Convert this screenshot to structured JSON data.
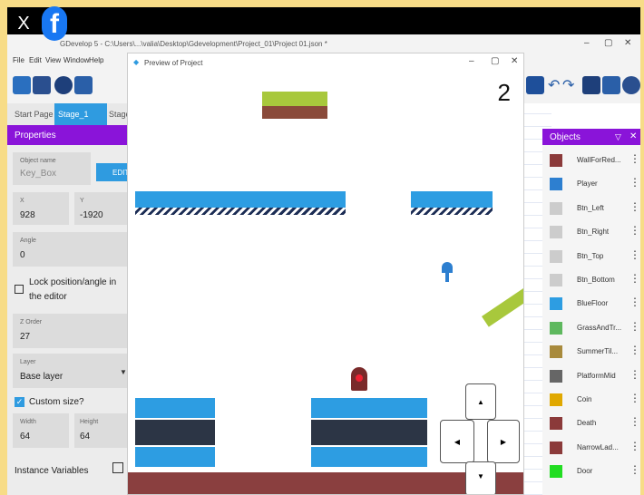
{
  "overlay": {
    "close": "X",
    "fb": "f"
  },
  "editor": {
    "title": "GDevelop 5 - C:\\Users\\...\\valia\\Desktop\\Gdevelopment\\Project_01\\Project 01.json *",
    "menu": [
      "File",
      "Edit",
      "View",
      "Window",
      "Help"
    ],
    "tabs": [
      "Start Page",
      "Stage_1",
      "Stage"
    ]
  },
  "properties": {
    "header": "Properties",
    "object_name_label": "Object name",
    "object_name": "Key_Box",
    "edit_label": "EDIT",
    "x_label": "X",
    "x": "928",
    "y_label": "Y",
    "y": "-1920",
    "angle_label": "Angle",
    "angle": "0",
    "lock_label": "Lock position/angle in the editor",
    "zorder_label": "Z Order",
    "zorder": "27",
    "layer_label": "Layer",
    "layer": "Base layer",
    "custom_size_label": "Custom size?",
    "width_label": "Width",
    "width": "64",
    "height_label": "Height",
    "height": "64",
    "instance_vars": "Instance Variables"
  },
  "preview": {
    "title": "Preview of Project",
    "score": "2"
  },
  "objects": {
    "header": "Objects",
    "items": [
      {
        "name": "WallForRed...",
        "color": "#8b3a3a"
      },
      {
        "name": "Player",
        "color": "#2d7fd0"
      },
      {
        "name": "Btn_Left",
        "color": "#cccccc"
      },
      {
        "name": "Btn_Right",
        "color": "#cccccc"
      },
      {
        "name": "Btn_Top",
        "color": "#cccccc"
      },
      {
        "name": "Btn_Bottom",
        "color": "#cccccc"
      },
      {
        "name": "BlueFloor",
        "color": "#2d9de2"
      },
      {
        "name": "GrassAndTr...",
        "color": "#5eb85e"
      },
      {
        "name": "SummerTil...",
        "color": "#a88a3c"
      },
      {
        "name": "PlatformMid",
        "color": "#666666"
      },
      {
        "name": "Coin",
        "color": "#e0a800"
      },
      {
        "name": "Death",
        "color": "#8b3a3a"
      },
      {
        "name": "NarrowLad...",
        "color": "#8b3a3a"
      },
      {
        "name": "Door",
        "color": "#22dd22"
      }
    ]
  }
}
